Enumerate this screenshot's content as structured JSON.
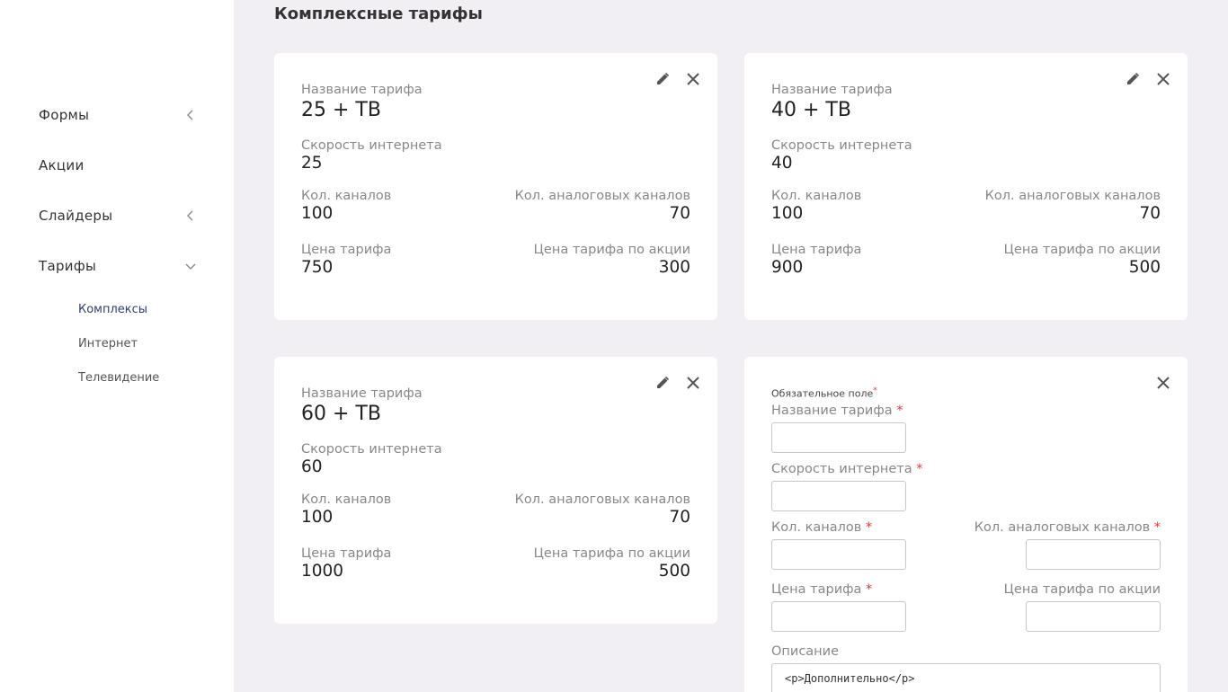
{
  "sidebar": {
    "items": [
      {
        "label": "Формы"
      },
      {
        "label": "Акции"
      },
      {
        "label": "Слайдеры"
      },
      {
        "label": "Тарифы"
      }
    ],
    "subitems": [
      {
        "label": "Комплексы"
      },
      {
        "label": "Интернет"
      },
      {
        "label": "Телевидение"
      }
    ]
  },
  "page": {
    "title": "Комплексные тарифы"
  },
  "labels": {
    "name": "Название тарифа",
    "speed": "Скорость интернета",
    "channels": "Кол. каналов",
    "analog": "Кол. аналоговых каналов",
    "price": "Цена тарифа",
    "promo": "Цена тарифа по акции"
  },
  "cards": [
    {
      "name": "25 + ТВ",
      "speed": "25",
      "channels": "100",
      "analog": "70",
      "price": "750",
      "promo": "300"
    },
    {
      "name": "40 + ТВ",
      "speed": "40",
      "channels": "100",
      "analog": "70",
      "price": "900",
      "promo": "500"
    },
    {
      "name": "60 + ТВ",
      "speed": "60",
      "channels": "100",
      "analog": "70",
      "price": "1000",
      "promo": "500"
    }
  ],
  "form": {
    "required_note": "Обязательное поле",
    "required_mark": "*",
    "name_label": "Название тарифа",
    "speed_label": "Скорость интернета",
    "channels_label": "Кол. каналов",
    "analog_label": "Кол. аналоговых каналов",
    "price_label": "Цена тарифа",
    "promo_label": "Цена тарифа по акции",
    "description_label": "Описание",
    "description_value": "<p>Дополнительно</p>"
  },
  "colors": {
    "background": "#f1eef4",
    "accent": "#2c3e7a",
    "required": "#e53935"
  },
  "icons": {
    "edit": "pencil-icon",
    "close": "close-icon",
    "collapsed": "chevron-left-icon",
    "expanded": "chevron-down-icon"
  }
}
